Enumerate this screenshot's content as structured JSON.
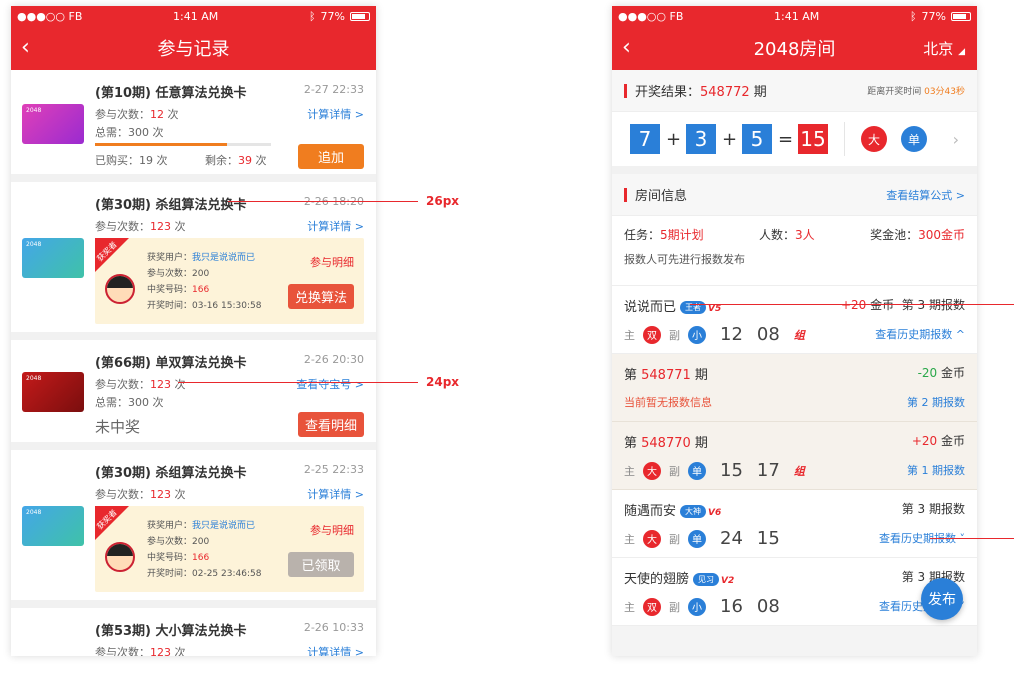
{
  "status": {
    "carrier": "●●●○○ FB",
    "time": "1:41 AM",
    "battery": "77%"
  },
  "left": {
    "nav_title": "参与记录",
    "records": [
      {
        "title": "(第10期) 任意算法兑换卡",
        "time": "2-27 22:33",
        "l1_label": "参与次数：",
        "l1_value": "12",
        "l1_unit": " 次",
        "l2": "总需：300 次",
        "link": "计算详情 >",
        "bought": "已购买：19 次",
        "remain_label": "剩余：",
        "remain_value": "39",
        "remain_unit": " 次",
        "progress": 0.75,
        "button": "追加"
      },
      {
        "title": "(第30期) 杀组算法兑换卡",
        "time": "2-26 18:20",
        "l1_label": "参与次数：",
        "l1_value": "123",
        "l1_unit": " 次",
        "link": "计算详情 >",
        "ribbon": "获奖者",
        "p_user_label": "获奖用户：",
        "p_user": "我只是说说而已",
        "p_count": "参与次数：200",
        "p_code_label": "中奖号码：",
        "p_code": "166",
        "p_time": "开奖时间：03-16 15:30:58",
        "p_detail": "参与明细",
        "button": "兑换算法"
      },
      {
        "title": "(第66期) 单双算法兑换卡",
        "time": "2-26 20:30",
        "l1_label": "参与次数：",
        "l1_value": "123",
        "l1_unit": " 次",
        "l2": "总需：300 次",
        "link": "查看夺宝号 >",
        "lost": "未中奖",
        "button": "查看明细"
      },
      {
        "title": "(第30期) 杀组算法兑换卡",
        "time": "2-25 22:33",
        "l1_label": "参与次数：",
        "l1_value": "123",
        "l1_unit": " 次",
        "link": "计算详情 >",
        "ribbon": "获奖者",
        "p_user_label": "获奖用户：",
        "p_user": "我只是说说而已",
        "p_count": "参与次数：200",
        "p_code_label": "中奖号码：",
        "p_code": "166",
        "p_time": "开奖时间：02-25 23:46:58",
        "p_detail": "参与明细",
        "button": "已领取"
      },
      {
        "title": "(第53期) 大小算法兑换卡",
        "time": "2-26 10:33",
        "l1_label": "参与次数：",
        "l1_value": "123",
        "l1_unit": " 次",
        "link": "计算详情 >"
      }
    ]
  },
  "annotations": {
    "a1": "26px",
    "a2": "24px"
  },
  "right": {
    "nav_title": "2048房间",
    "city": "北京",
    "result_label": "开奖结果：",
    "result_period": "548772",
    "result_unit": "期",
    "countdown_label": "距离开奖时间",
    "countdown": "03分43秒",
    "nums": [
      "7",
      "3",
      "5"
    ],
    "sum": "15",
    "big": "大",
    "single": "单",
    "room_info": "房间信息",
    "formula": "查看结算公式 >",
    "task_label": "任务：",
    "task_value": "5期计划",
    "people_label": "人数：",
    "people_value": "3人",
    "pool_label": "奖金池：",
    "pool_value": "300金币",
    "rule": "报数人可先进行报数发布",
    "rows": [
      {
        "name": "说说而已",
        "tag": "王者",
        "v": "V5",
        "coin": "+20",
        "coin_unit": " 金币",
        "period": "第 3 期报数",
        "a": "双",
        "b": "小",
        "n1": "12",
        "n2": "08",
        "flag": "组",
        "hist": "查看历史期报数 ^"
      },
      {
        "period_no_label": "第 ",
        "period_no": "548771",
        "period_unit": " 期",
        "coin": "-20",
        "coin_unit": " 金币",
        "nodata": "当前暂无报数信息",
        "report": "第 2 期报数"
      },
      {
        "period_no_label": "第 ",
        "period_no": "548770",
        "period_unit": " 期",
        "coin": "+20",
        "coin_unit": " 金币",
        "a": "大",
        "b": "单",
        "n1": "15",
        "n2": "17",
        "flag": "组",
        "report": "第 1 期报数"
      },
      {
        "name": "随遇而安",
        "tag": "大神",
        "v": "V6",
        "period": "第 3 期报数",
        "a": "大",
        "b": "单",
        "n1": "24",
        "n2": "15",
        "hist": "查看历史期报数 ˅"
      },
      {
        "name": "天使的翅膀",
        "tag": "见习",
        "v": "V2",
        "period": "第 3 期报数",
        "a": "双",
        "b": "小",
        "n1": "16",
        "n2": "08",
        "hist": "查看历史期报数 ˅"
      }
    ],
    "fab": "发布"
  },
  "colors": {
    "red": "#e8282d",
    "blue": "#2a7fd8",
    "orange": "#f07d1f"
  }
}
